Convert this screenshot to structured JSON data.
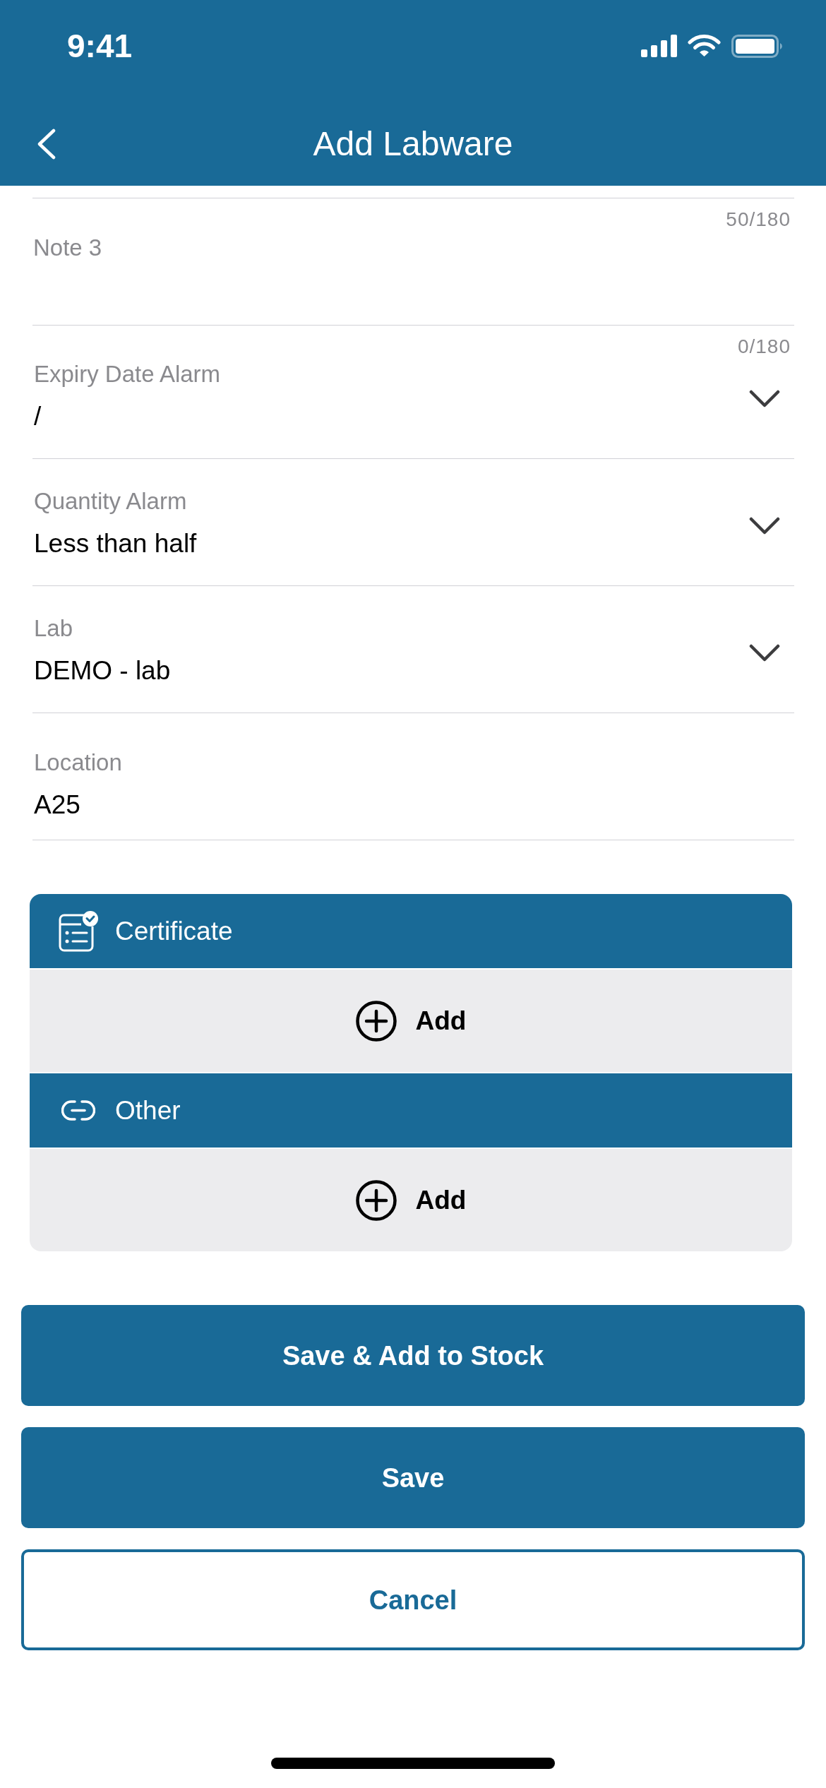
{
  "status_bar": {
    "time": "9:41"
  },
  "nav_bar": {
    "title": "Add Labware"
  },
  "form": [
    {
      "kind": "counter",
      "text": "50/180"
    },
    {
      "kind": "note",
      "placeholder": "Note 3"
    },
    {
      "kind": "counter",
      "text": "0/180"
    },
    {
      "kind": "select",
      "label": "Expiry Date Alarm",
      "value": "/"
    },
    {
      "kind": "select",
      "label": "Quantity Alarm",
      "value": "Less than half"
    },
    {
      "kind": "select",
      "label": "Lab",
      "value": "DEMO - lab"
    },
    {
      "kind": "text",
      "label": "Location",
      "value": "A25"
    }
  ],
  "attachments": [
    {
      "kind": "certificate",
      "title": "Certificate",
      "action": "Add"
    },
    {
      "kind": "link",
      "title": "Other",
      "action": "Add"
    }
  ],
  "buttons": [
    {
      "kind": "primary",
      "label": "Save & Add to Stock"
    },
    {
      "kind": "primary",
      "label": "Save"
    },
    {
      "kind": "outline",
      "label": "Cancel"
    }
  ]
}
